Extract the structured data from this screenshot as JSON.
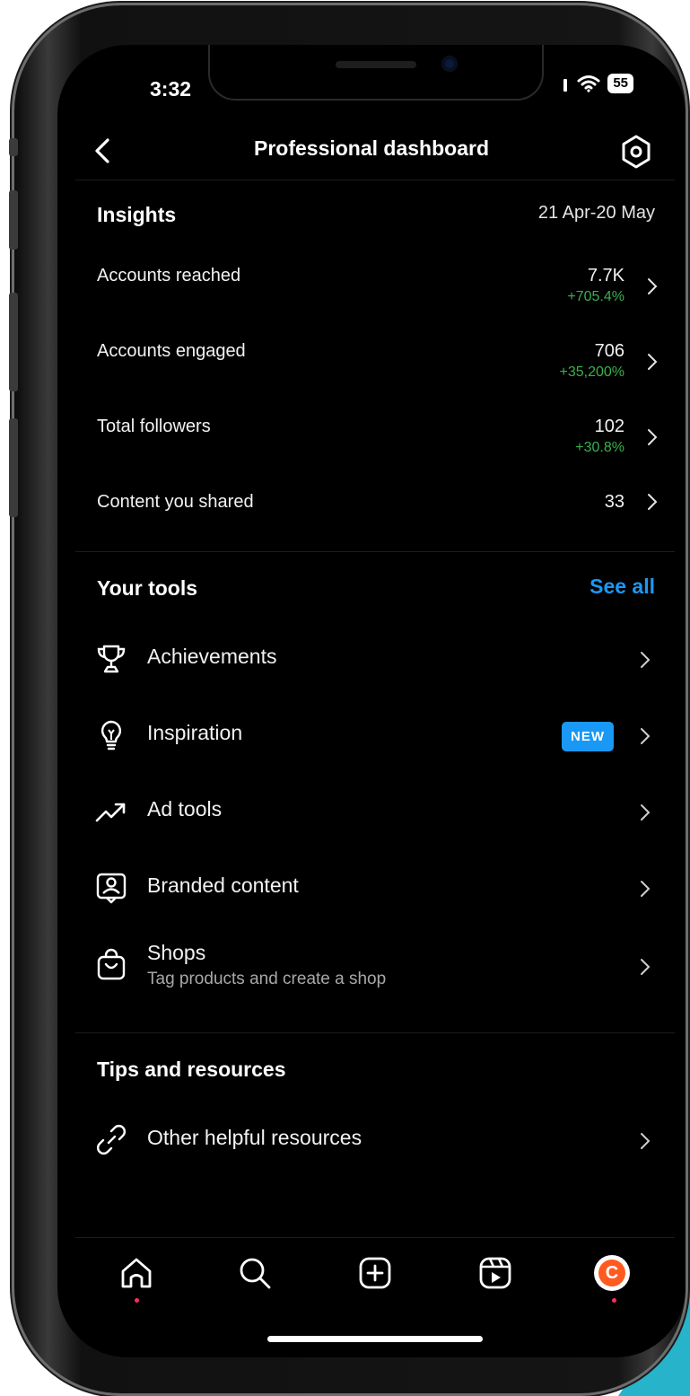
{
  "status_bar": {
    "time": "3:32",
    "battery": "55"
  },
  "header": {
    "title": "Professional dashboard"
  },
  "insights": {
    "title": "Insights",
    "date_range": "21 Apr-20 May",
    "metrics": [
      {
        "label": "Accounts reached",
        "value": "7.7K",
        "change": "+705.4%"
      },
      {
        "label": "Accounts engaged",
        "value": "706",
        "change": "+35,200%"
      },
      {
        "label": "Total followers",
        "value": "102",
        "change": "+30.8%"
      },
      {
        "label": "Content you shared",
        "value": "33",
        "change": ""
      }
    ]
  },
  "tools": {
    "title": "Your tools",
    "see_all": "See all",
    "items": [
      {
        "label": "Achievements",
        "icon": "trophy-icon"
      },
      {
        "label": "Inspiration",
        "icon": "lightbulb-icon",
        "badge": "NEW"
      },
      {
        "label": "Ad tools",
        "icon": "trending-up-icon"
      },
      {
        "label": "Branded content",
        "icon": "branded-content-icon"
      },
      {
        "label": "Shops",
        "sublabel": "Tag products and create a shop",
        "icon": "shopping-bag-icon"
      }
    ]
  },
  "tips": {
    "title": "Tips and resources",
    "items": [
      {
        "label": "Other helpful resources",
        "icon": "link-icon"
      }
    ]
  },
  "bottom_nav": {
    "items": [
      "home-icon",
      "search-icon",
      "create-icon",
      "reels-icon",
      "profile-avatar"
    ],
    "avatar_letter": "C"
  },
  "colors": {
    "accent": "#1a98f5",
    "positive": "#37b24d",
    "background": "#000000",
    "notification_dot": "#ff2d55"
  }
}
